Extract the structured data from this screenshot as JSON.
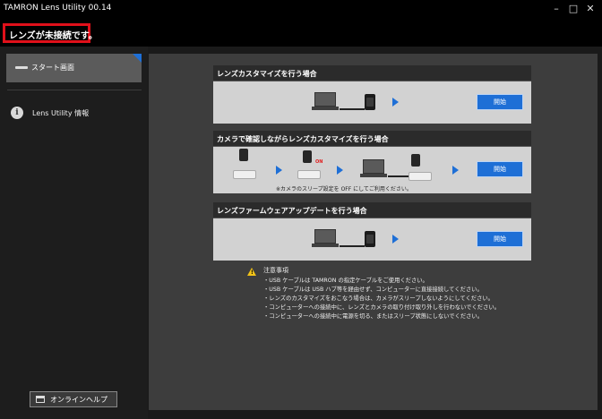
{
  "window": {
    "title": "TAMRON Lens Utility 00.14",
    "minimize_glyph": "–",
    "maximize_glyph": "□",
    "close_glyph": "✕"
  },
  "status": {
    "message": "レンズが未接続です。",
    "border_color": "#e0101a"
  },
  "sidebar": {
    "start": {
      "label": "スタート画面",
      "icon": "lens-icon"
    },
    "info": {
      "label": "Lens Utility 情報",
      "icon": "info-icon",
      "glyph": "i"
    },
    "help": {
      "label": "オンラインヘルプ",
      "icon": "window-icon"
    }
  },
  "panels": {
    "customize": {
      "title": "レンズカスタマイズを行う場合",
      "button": "開始"
    },
    "camera_customize": {
      "title": "カメラで確認しながらレンズカスタマイズを行う場合",
      "button": "開始",
      "on_label": "ON",
      "note": "※カメラのスリープ設定を OFF にしてご利用ください。"
    },
    "firmware": {
      "title": "レンズファームウェアアップデートを行う場合",
      "button": "開始"
    }
  },
  "notes": {
    "title": "注意事項",
    "items": [
      "・USB ケーブルは TAMRON の指定ケーブルをご使用ください。",
      "・USB ケーブルは USB ハブ等を経由せず、コンピューターに直接接続してください。",
      "・レンズのカスタマイズをおこなう場合は、カメラがスリープしないようにしてください。",
      "・コンピューターへの接続中に、レンズとカメラの取り付け取り外しを行わないでください。",
      "・コンピューターへの接続中に電源を切る、またはスリープ状態にしないでください。"
    ]
  },
  "colors": {
    "accent": "#1e6fd6",
    "warning": "#f2c318",
    "background": "#000000"
  }
}
